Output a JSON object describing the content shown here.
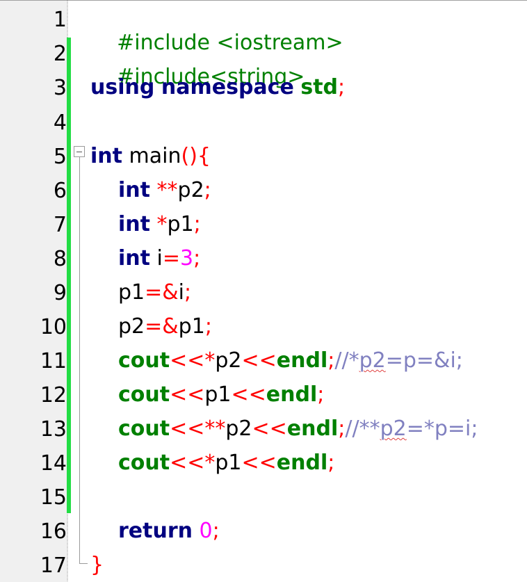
{
  "editor": {
    "line_numbers": [
      "1",
      "2",
      "3",
      "4",
      "5",
      "6",
      "7",
      "8",
      "9",
      "10",
      "11",
      "12",
      "13",
      "14",
      "15",
      "16",
      "17"
    ],
    "changed_lines_range": [
      2,
      15
    ],
    "fold_marker_line": 5,
    "colors": {
      "preprocessor": "#008000",
      "keyword_blue": "#000080",
      "keyword_green": "#008000",
      "operator": "#ff0000",
      "number": "#ff00ff",
      "comment": "#8080c0",
      "change_bar": "#22dd44"
    },
    "code": {
      "l1": {
        "text": "#include <iostream>"
      },
      "l2": {
        "text": "#include<string>"
      },
      "l3": {
        "kw1": "using",
        "kw2": "namespace",
        "std": "std",
        "semi": ";"
      },
      "l5": {
        "kw": "int",
        "name": " main",
        "punct": "(){"
      },
      "l6": {
        "kw": "int",
        "ops": " **",
        "id": "p2",
        "semi": ";"
      },
      "l7": {
        "kw": "int",
        "ops": " *",
        "id": "p1",
        "semi": ";"
      },
      "l8": {
        "kw": "int",
        "id": " i",
        "eq": "=",
        "num": "3",
        "semi": ";"
      },
      "l9": {
        "id1": "p1",
        "op": "=&",
        "id2": "i",
        "semi": ";"
      },
      "l10": {
        "id1": "p2",
        "op": "=&",
        "id2": "p1",
        "semi": ";"
      },
      "l11": {
        "cout": "cout",
        "op1": "<<*",
        "id": "p2",
        "op2": "<<",
        "endl": "endl",
        "semi": ";",
        "c1": "//*",
        "c2": "p2",
        "c3": "=p=&i;"
      },
      "l12": {
        "cout": "cout",
        "op1": "<<",
        "id": "p1",
        "op2": "<<",
        "endl": "endl",
        "semi": ";"
      },
      "l13": {
        "cout": "cout",
        "op1": "<<**",
        "id": "p2",
        "op2": "<<",
        "endl": "endl",
        "semi": ";",
        "c1": "//**",
        "c2": "p2",
        "c3": "=*p=i;"
      },
      "l14": {
        "cout": "cout",
        "op1": "<<*",
        "id": "p1",
        "op2": "<<",
        "endl": "endl",
        "semi": ";"
      },
      "l16": {
        "kw": "return",
        "num": " 0",
        "semi": ";"
      },
      "l17": {
        "brace": "}"
      }
    }
  }
}
